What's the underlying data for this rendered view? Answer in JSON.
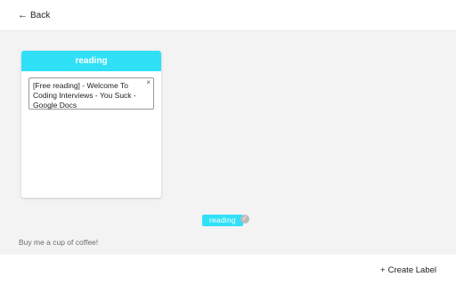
{
  "header": {
    "back_arrow": "←",
    "back_label": "Back"
  },
  "board": {
    "title": "reading",
    "header_color": "#2fe0f7",
    "cards": [
      {
        "text": "[Free reading] - Welcome To Coding Interviews - You Suck - Google Docs",
        "close_glyph": "×"
      }
    ]
  },
  "label_chip": {
    "label": "reading",
    "check_glyph": "✓"
  },
  "footer": {
    "coffee_link": "Buy me a cup of coffee!",
    "create_label_plus": "+",
    "create_label": "Create Label"
  },
  "icons": {
    "back": "arrow-left-icon",
    "card_close": "close-icon",
    "chip_check": "check-icon",
    "create": "plus-icon"
  }
}
